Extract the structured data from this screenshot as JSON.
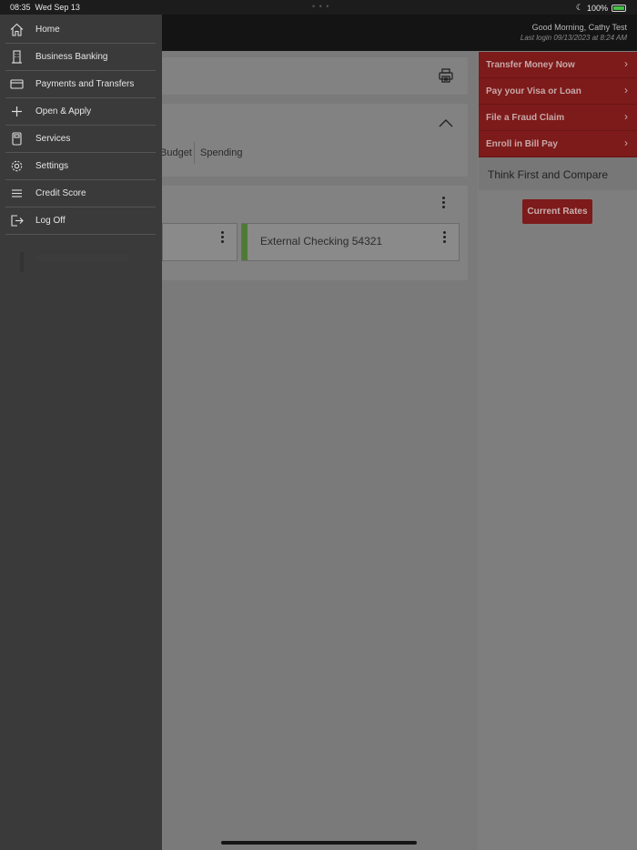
{
  "status_bar": {
    "time": "08:35",
    "date": "Wed Sep 13",
    "battery": "100%"
  },
  "header": {
    "greeting": "Good Morning, Cathy Test",
    "last_login": "Last login 09/13/2023 at 8:24 AM"
  },
  "overview": {
    "tabs": [
      "Budget",
      "Spending"
    ],
    "accounts": [
      {
        "name": ""
      },
      {
        "name": "External Checking 54321"
      }
    ]
  },
  "quick_links": [
    {
      "label": "Transfer Money Now"
    },
    {
      "label": "Pay your Visa or Loan"
    },
    {
      "label": "File a Fraud Claim"
    },
    {
      "label": "Enroll in Bill Pay"
    }
  ],
  "promo": {
    "title": "Think First and Compare",
    "button_label": "Current Rates"
  },
  "menu": {
    "items": [
      {
        "label": "Home",
        "icon": "home-icon"
      },
      {
        "label": "Business Banking",
        "icon": "building-icon"
      },
      {
        "label": "Payments and Transfers",
        "icon": "credit-card-icon"
      },
      {
        "label": "Open & Apply",
        "icon": "plus-icon"
      },
      {
        "label": "Services",
        "icon": "calculator-icon"
      },
      {
        "label": "Settings",
        "icon": "gear-icon"
      },
      {
        "label": "Credit Score",
        "icon": "menu-lines-icon"
      },
      {
        "label": "Log Off",
        "icon": "logout-icon"
      }
    ]
  },
  "colors": {
    "accent_red": "#7d1a1a",
    "drawer_bg": "#3a3a3a",
    "header_bg": "#141414"
  }
}
